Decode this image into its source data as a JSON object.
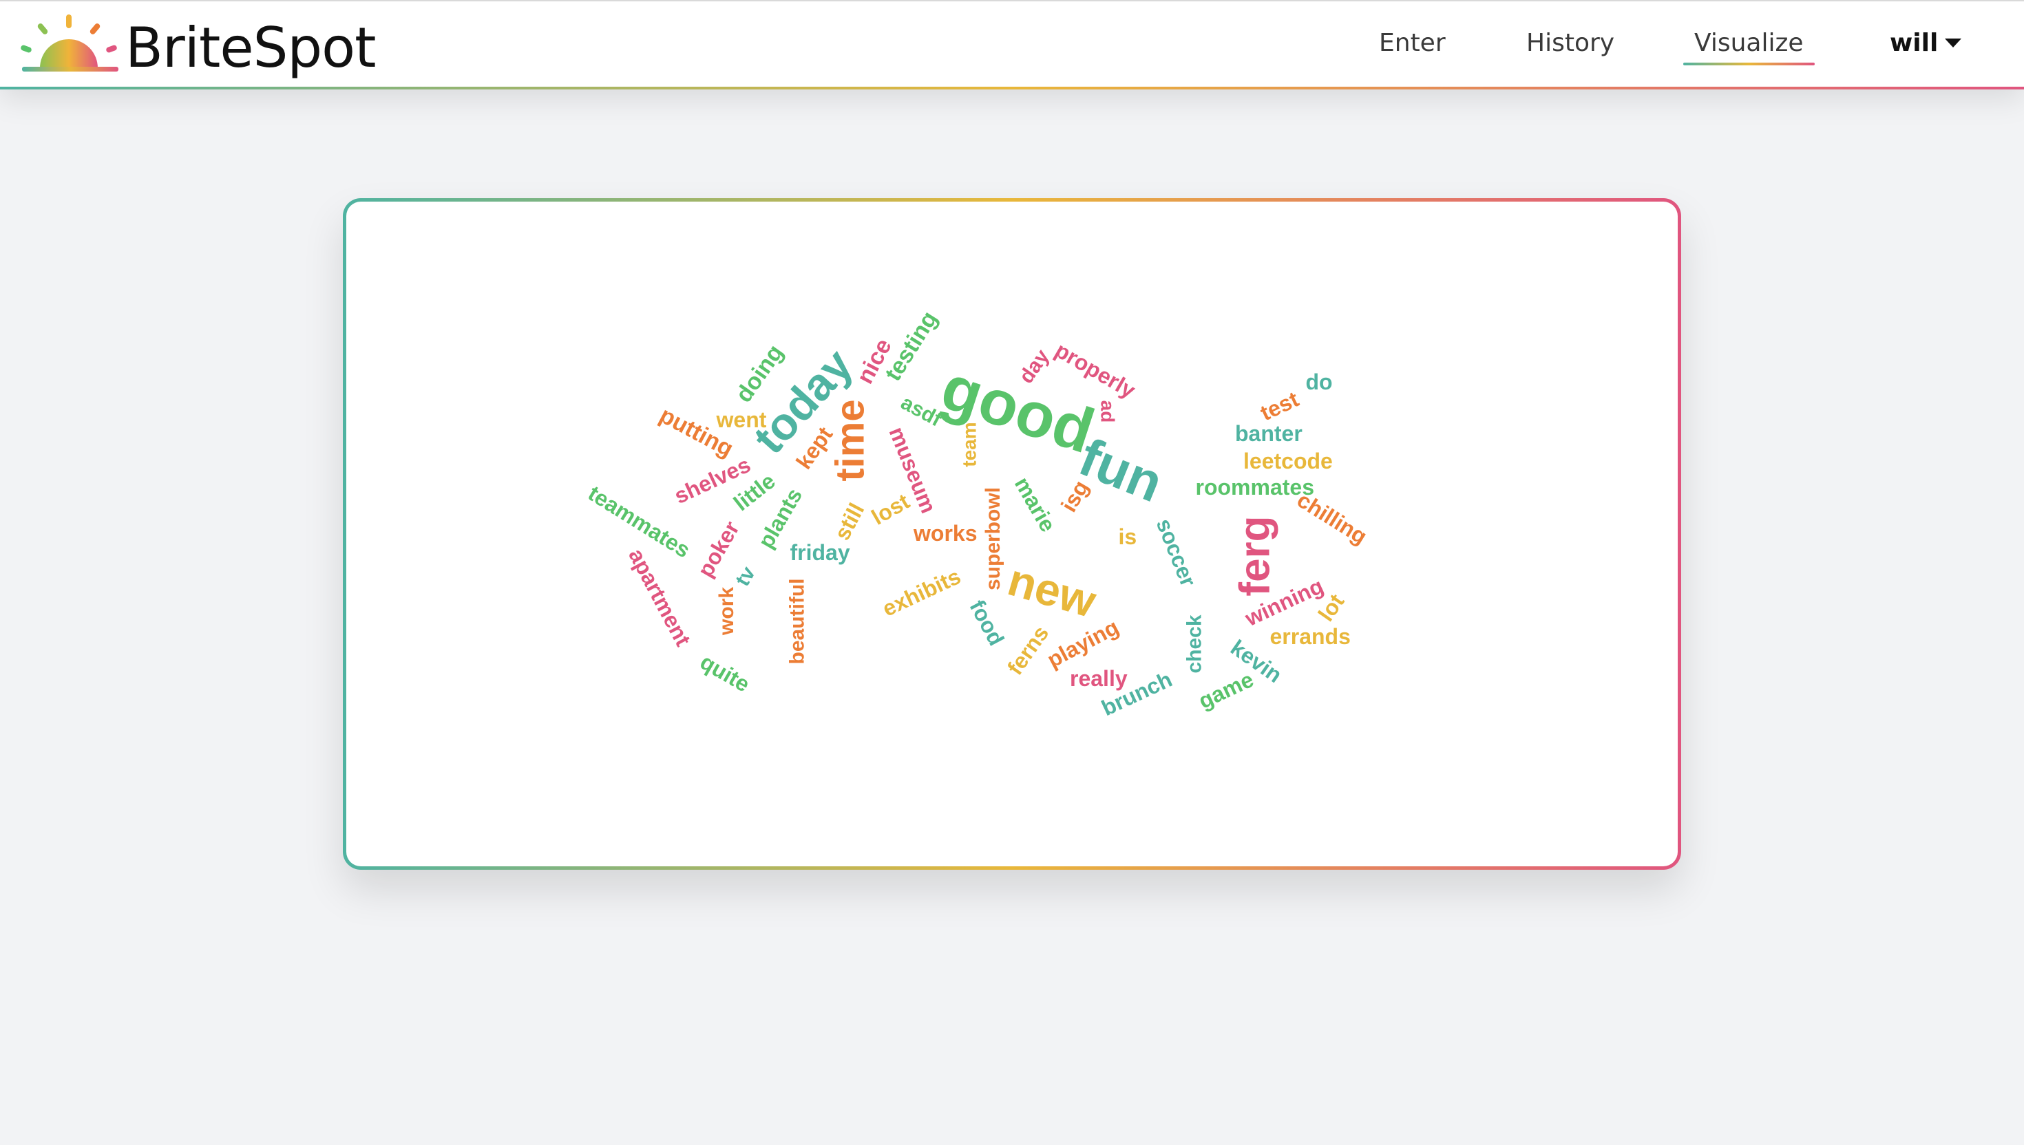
{
  "app": {
    "brand_name": "BriteSpot",
    "logo_icon": "sunrise-logo-icon"
  },
  "nav": {
    "items": [
      {
        "label": "Enter",
        "active": false
      },
      {
        "label": "History",
        "active": false
      },
      {
        "label": "Visualize",
        "active": true
      }
    ],
    "user": {
      "label": "will",
      "icon": "caret-down-icon"
    }
  },
  "colors": {
    "teal": "#4fb3a1",
    "green": "#59c36a",
    "yellow": "#e8b73a",
    "orange": "#ec7d35",
    "pink": "#e0557f"
  },
  "word_cloud": {
    "words": [
      {
        "text": "good"
      },
      {
        "text": "fun"
      },
      {
        "text": "today"
      },
      {
        "text": "time"
      },
      {
        "text": "ferg"
      },
      {
        "text": "new"
      },
      {
        "text": "testing"
      },
      {
        "text": "nice"
      },
      {
        "text": "doing"
      },
      {
        "text": "went"
      },
      {
        "text": "putting"
      },
      {
        "text": "kept"
      },
      {
        "text": "asdf"
      },
      {
        "text": "museum"
      },
      {
        "text": "team"
      },
      {
        "text": "day"
      },
      {
        "text": "properly"
      },
      {
        "text": "ad"
      },
      {
        "text": "test"
      },
      {
        "text": "do"
      },
      {
        "text": "banter"
      },
      {
        "text": "leetcode"
      },
      {
        "text": "roommates"
      },
      {
        "text": "chilling"
      },
      {
        "text": "shelves"
      },
      {
        "text": "little"
      },
      {
        "text": "plants"
      },
      {
        "text": "still"
      },
      {
        "text": "lost"
      },
      {
        "text": "works"
      },
      {
        "text": "superbowl"
      },
      {
        "text": "marie"
      },
      {
        "text": "isg"
      },
      {
        "text": "is"
      },
      {
        "text": "soccer"
      },
      {
        "text": "teammates"
      },
      {
        "text": "poker"
      },
      {
        "text": "friday"
      },
      {
        "text": "tv"
      },
      {
        "text": "apartment"
      },
      {
        "text": "work"
      },
      {
        "text": "beautiful"
      },
      {
        "text": "exhibits"
      },
      {
        "text": "food"
      },
      {
        "text": "ferns"
      },
      {
        "text": "playing"
      },
      {
        "text": "really"
      },
      {
        "text": "brunch"
      },
      {
        "text": "check"
      },
      {
        "text": "game"
      },
      {
        "text": "kevin"
      },
      {
        "text": "errands"
      },
      {
        "text": "lot"
      },
      {
        "text": "winning"
      },
      {
        "text": "quite"
      }
    ]
  }
}
